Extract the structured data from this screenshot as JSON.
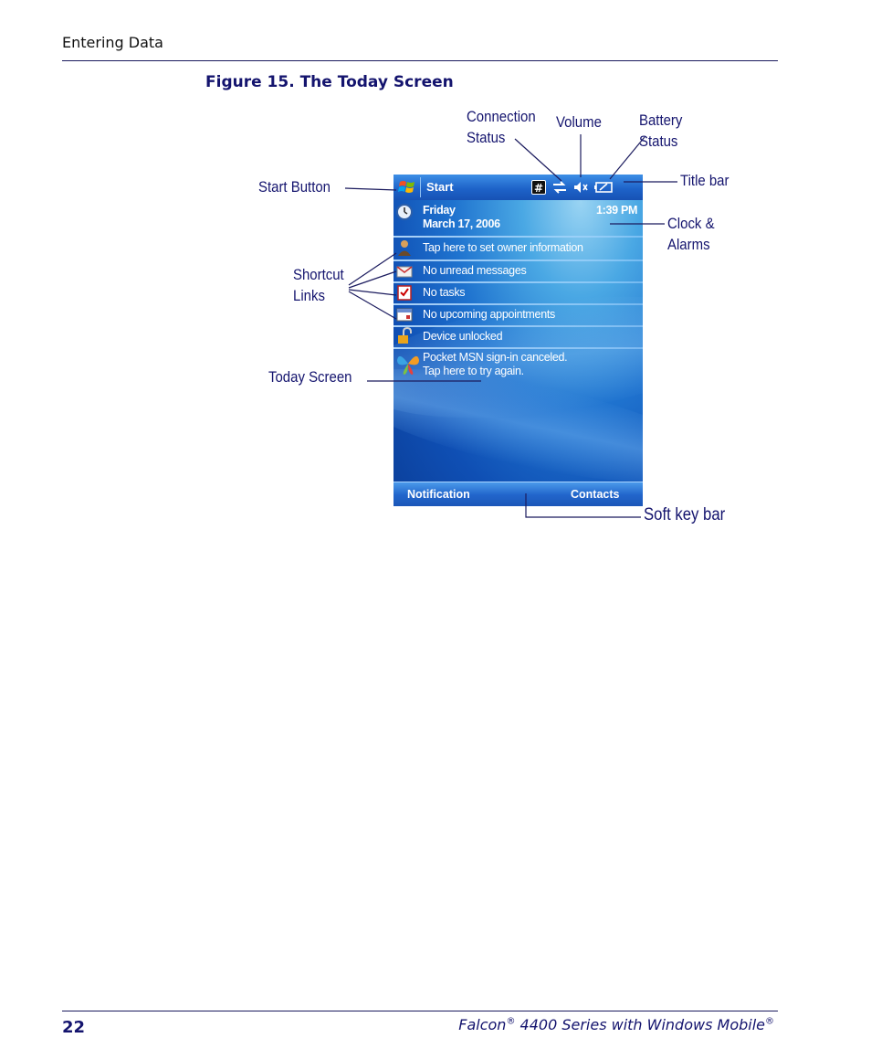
{
  "header": {
    "section": "Entering Data"
  },
  "figure": {
    "title": "Figure 15. The Today Screen"
  },
  "callouts": {
    "connection": "Connection\nStatus",
    "volume": "Volume",
    "battery": "Battery\nStatus",
    "title_bar": "Title bar",
    "start_button": "Start Button",
    "clock": "Clock &\nAlarms",
    "shortcut": "Shortcut\nLinks",
    "today": "Today Screen",
    "soft_key": "Soft key bar"
  },
  "screen": {
    "title_bar": {
      "start_label": "Start",
      "input_glyph": "#"
    },
    "date": {
      "day": "Friday",
      "date": "March 17, 2006",
      "time": "1:39 PM"
    },
    "items": [
      {
        "label": "Tap here to set owner information",
        "icon": "owner-icon"
      },
      {
        "label": "No unread messages",
        "icon": "envelope-icon"
      },
      {
        "label": "No tasks",
        "icon": "tasks-icon"
      },
      {
        "label": "No upcoming appointments",
        "icon": "calendar-icon"
      },
      {
        "label": "Device unlocked",
        "icon": "padlock-icon"
      }
    ],
    "msn": {
      "line1": "Pocket MSN sign-in canceled.",
      "line2": "Tap here to try again."
    },
    "softkeys": {
      "left": "Notification",
      "right": "Contacts"
    },
    "colors": {
      "title_bar": "#1e63c9",
      "background": "#1f73cf"
    }
  },
  "footer": {
    "page": "22",
    "title_a": "Falcon",
    "reg1": "®",
    "title_b": " 4400 Series with Windows Mobile",
    "reg2": "®"
  }
}
